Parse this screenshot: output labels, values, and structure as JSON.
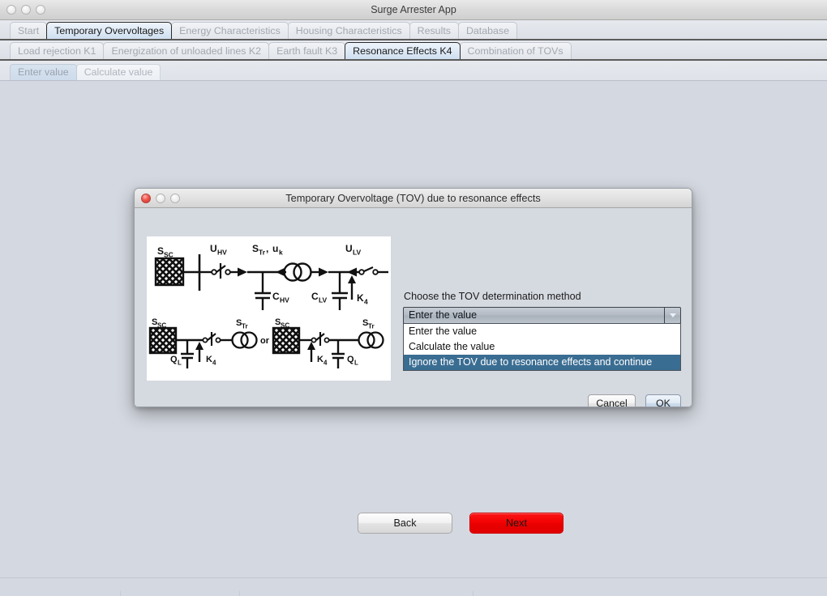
{
  "main_window": {
    "title": "Surge Arrester App",
    "traffic_lights": [
      "close",
      "minimize",
      "zoom"
    ],
    "tabs_primary": [
      {
        "label": "Start",
        "selected": false
      },
      {
        "label": "Temporary Overvoltages",
        "selected": true
      },
      {
        "label": "Energy Characteristics",
        "selected": false
      },
      {
        "label": "Housing Characteristics",
        "selected": false
      },
      {
        "label": "Results",
        "selected": false
      },
      {
        "label": "Database",
        "selected": false
      }
    ],
    "tabs_secondary": [
      {
        "label": "Load rejection K1",
        "selected": false
      },
      {
        "label": "Energization of unloaded lines K2",
        "selected": false
      },
      {
        "label": "Earth fault K3",
        "selected": false
      },
      {
        "label": "Resonance Effects K4",
        "selected": true
      },
      {
        "label": "Combination of TOVs",
        "selected": false
      }
    ],
    "tabs_tertiary": [
      {
        "label": "Enter value",
        "selected": true
      },
      {
        "label": "Calculate value",
        "selected": false
      }
    ],
    "nav": {
      "back_label": "Back",
      "next_label": "Next",
      "next_color": "#f20000"
    }
  },
  "dialog": {
    "title": "Temporary Overvoltage (TOV) due to resonance effects",
    "traffic_lights": [
      "close",
      "minimize",
      "zoom"
    ],
    "method_label": "Choose the TOV determination method",
    "combo": {
      "selected_value": "Enter the value",
      "arrow_icon": "chevron-down-icon",
      "expanded": true
    },
    "options": [
      {
        "label": "Enter the value",
        "highlighted": false
      },
      {
        "label": "Calculate the value",
        "highlighted": false
      },
      {
        "label": "Ignore the TOV due to resonance effects and continue",
        "highlighted": true
      }
    ],
    "highlight_color": "#3a6d92",
    "cancel_label": "Cancel",
    "ok_label": "OK",
    "diagram": {
      "alt": "Resonance effects circuit diagram",
      "labels_top": [
        "S_SC",
        "U_HV",
        "S_Tr , u_k",
        "U_LV",
        "C_HV",
        "C_LV",
        "K_4"
      ],
      "labels_bottom": [
        "S_SC",
        "S_Tr",
        "Q_L",
        "K_4",
        "or",
        "S_SC",
        "K_4",
        "Q_L",
        "S_Tr"
      ],
      "top_row": {
        "S_SC": "S",
        "S_SC_sub": "SC",
        "U_HV": "U",
        "U_HV_sub": "HV",
        "S_Tr": "S",
        "S_Tr_sub": "Tr",
        "comma": " , ",
        "u_k": "u",
        "u_k_sub": "k",
        "U_LV": "U",
        "U_LV_sub": "LV",
        "C_HV": "C",
        "C_HV_sub": "HV",
        "C_LV": "C",
        "C_LV_sub": "LV",
        "K4": "K",
        "K4_sub": "4"
      },
      "bottom_row": {
        "S_SC": "S",
        "S_SC_sub": "SC",
        "S_Tr": "S",
        "S_Tr_sub": "Tr",
        "Q_L": "Q",
        "Q_L_sub": "L",
        "K4": "K",
        "K4_sub": "4",
        "or": "or"
      }
    }
  }
}
